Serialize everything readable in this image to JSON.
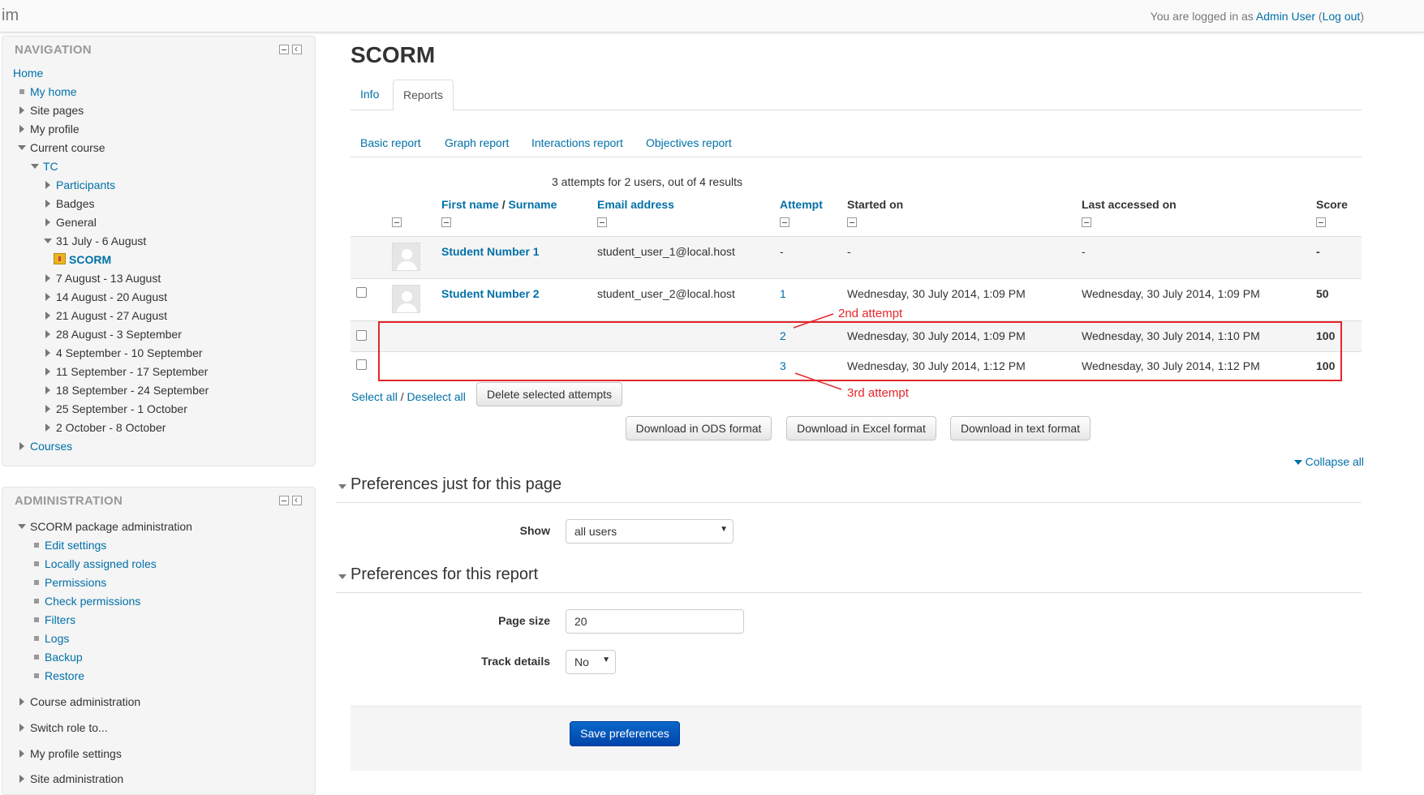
{
  "header": {
    "brand": "im",
    "login_prefix": "You are logged in as ",
    "user_name": "Admin User",
    "logout_open": " (",
    "logout_label": "Log out",
    "logout_close": ")"
  },
  "navigation": {
    "title": "NAVIGATION",
    "items": [
      {
        "label": "Home"
      },
      {
        "label": "My home"
      },
      {
        "label": "Site pages"
      },
      {
        "label": "My profile"
      },
      {
        "label": "Current course"
      },
      {
        "label": "TC"
      },
      {
        "label": "Participants"
      },
      {
        "label": "Badges"
      },
      {
        "label": "General"
      },
      {
        "label": "31 July - 6 August"
      },
      {
        "label": "SCORM"
      },
      {
        "label": "7 August - 13 August"
      },
      {
        "label": "14 August - 20 August"
      },
      {
        "label": "21 August - 27 August"
      },
      {
        "label": "28 August - 3 September"
      },
      {
        "label": "4 September - 10 September"
      },
      {
        "label": "11 September - 17 September"
      },
      {
        "label": "18 September - 24 September"
      },
      {
        "label": "25 September - 1 October"
      },
      {
        "label": "2 October - 8 October"
      },
      {
        "label": "Courses"
      }
    ]
  },
  "administration": {
    "title": "ADMINISTRATION",
    "items": [
      {
        "label": "SCORM package administration"
      },
      {
        "label": "Edit settings"
      },
      {
        "label": "Locally assigned roles"
      },
      {
        "label": "Permissions"
      },
      {
        "label": "Check permissions"
      },
      {
        "label": "Filters"
      },
      {
        "label": "Logs"
      },
      {
        "label": "Backup"
      },
      {
        "label": "Restore"
      },
      {
        "label": "Course administration"
      },
      {
        "label": "Switch role to..."
      },
      {
        "label": "My profile settings"
      },
      {
        "label": "Site administration"
      }
    ]
  },
  "main": {
    "title": "SCORM",
    "tabs": [
      {
        "label": "Info"
      },
      {
        "label": "Reports"
      }
    ],
    "subtabs": [
      {
        "label": "Basic report"
      },
      {
        "label": "Graph report"
      },
      {
        "label": "Interactions report"
      },
      {
        "label": "Objectives report"
      }
    ],
    "summary": "3 attempts for 2 users, out of 4 results",
    "columns": {
      "firstname": "First name",
      "sep": " / ",
      "surname": "Surname",
      "email": "Email address",
      "attempt": "Attempt",
      "started": "Started on",
      "last": "Last accessed on",
      "score": "Score"
    },
    "rows": [
      {
        "name": "Student Number 1",
        "email": "student_user_1@local.host",
        "attempt": "-",
        "started": "-",
        "last": "-",
        "score": "-"
      },
      {
        "name": "Student Number 2",
        "email": "student_user_2@local.host",
        "attempt": "1",
        "started": "Wednesday, 30 July 2014, 1:09 PM",
        "last": "Wednesday, 30 July 2014, 1:09 PM",
        "score": "50"
      },
      {
        "name": "",
        "email": "",
        "attempt": "2",
        "started": "Wednesday, 30 July 2014, 1:09 PM",
        "last": "Wednesday, 30 July 2014, 1:10 PM",
        "score": "100"
      },
      {
        "name": "",
        "email": "",
        "attempt": "3",
        "started": "Wednesday, 30 July 2014, 1:12 PM",
        "last": "Wednesday, 30 July 2014, 1:12 PM",
        "score": "100"
      }
    ],
    "annotations": {
      "second": "2nd attempt",
      "third": "3rd attempt"
    },
    "select_all": "Select all",
    "slash": " / ",
    "deselect_all": "Deselect all",
    "delete_button": "Delete selected attempts",
    "downloads": [
      "Download in ODS format",
      "Download in Excel format",
      "Download in text format"
    ],
    "collapse_all": "Collapse all",
    "prefs_page": {
      "legend": "Preferences just for this page",
      "show_label": "Show",
      "show_value": "all users"
    },
    "prefs_report": {
      "legend": "Preferences for this report",
      "pagesize_label": "Page size",
      "pagesize_value": "20",
      "track_label": "Track details",
      "track_value": "No"
    },
    "save_button": "Save preferences"
  },
  "colors": {
    "link": "#0070a8",
    "annotation": "#e5262a",
    "primary_button": "#0055bb"
  }
}
